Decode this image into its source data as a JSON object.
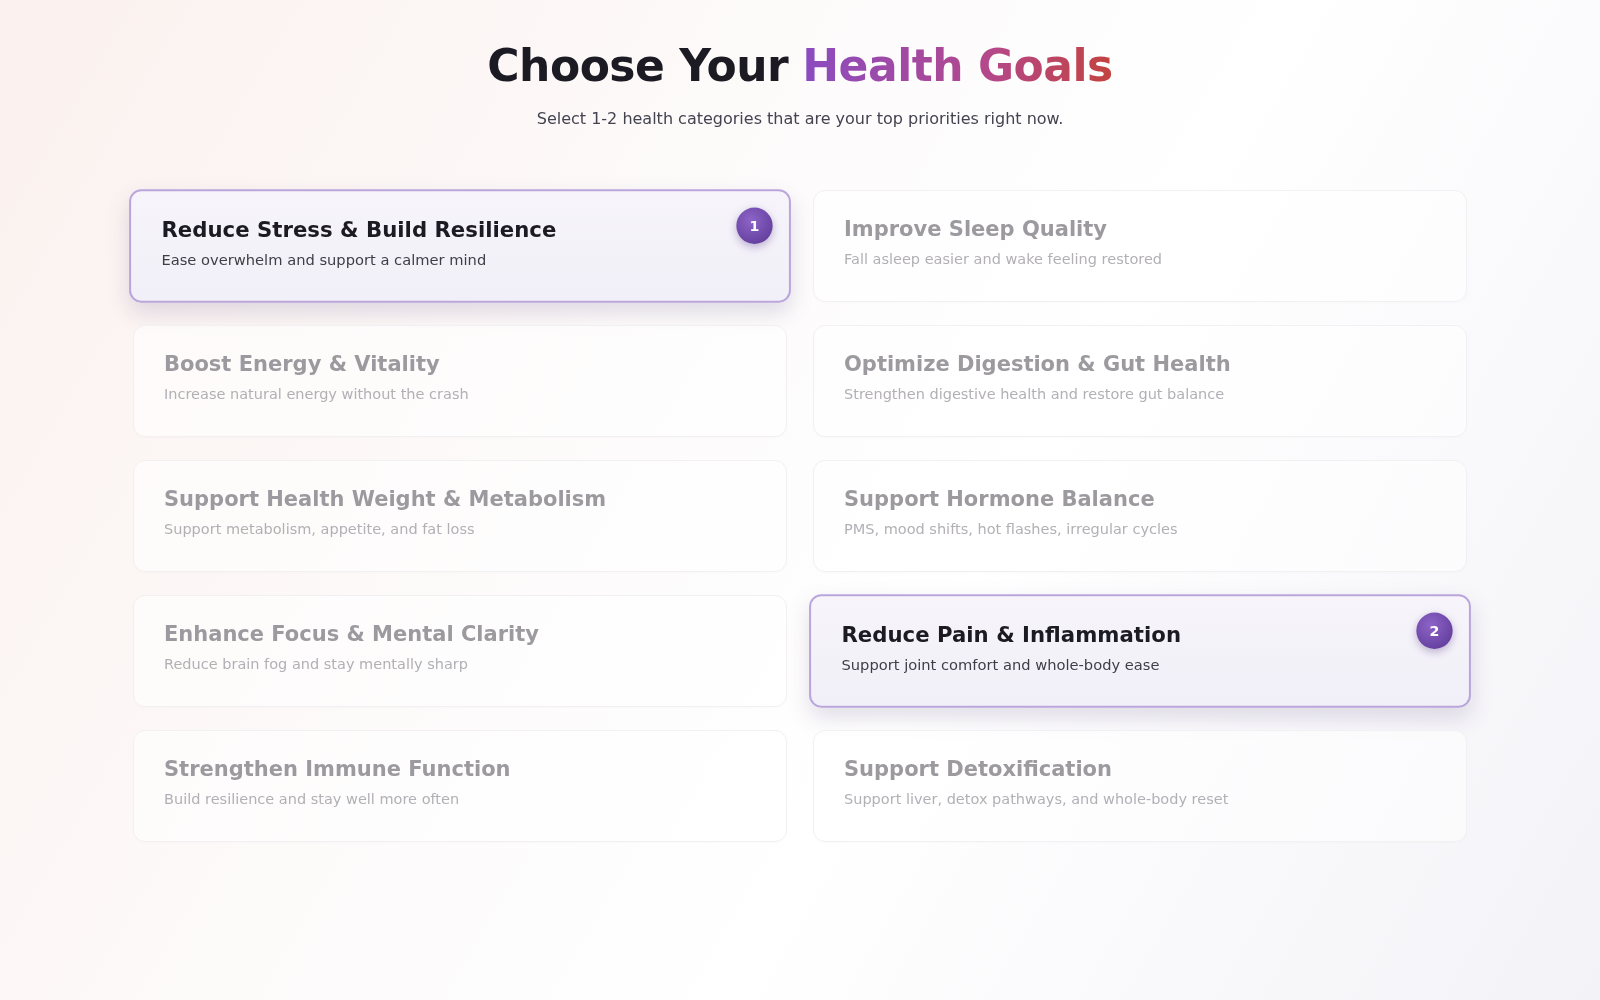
{
  "header": {
    "title": "Choose Your",
    "title_highlight": "Health Goals",
    "subtitle": "Select 1-2 health categories that are your top priorities right now."
  },
  "goals": [
    {
      "title": "Reduce Stress & Build Resilience",
      "description": "Ease overwhelm and support a calmer mind",
      "selected": true,
      "badge": "1"
    },
    {
      "title": "Improve Sleep Quality",
      "description": "Fall asleep easier and wake feeling restored",
      "selected": false
    },
    {
      "title": "Boost Energy & Vitality",
      "description": "Increase natural energy without the crash",
      "selected": false
    },
    {
      "title": "Optimize Digestion & Gut Health",
      "description": "Strengthen digestive health and restore gut balance",
      "selected": false
    },
    {
      "title": "Support Health Weight & Metabolism",
      "description": "Support metabolism, appetite, and fat loss",
      "selected": false
    },
    {
      "title": "Support Hormone Balance",
      "description": "PMS, mood shifts, hot flashes, irregular cycles",
      "selected": false
    },
    {
      "title": "Enhance Focus & Mental Clarity",
      "description": "Reduce brain fog and stay mentally sharp",
      "selected": false
    },
    {
      "title": "Reduce Pain & Inflammation",
      "description": "Support joint comfort and whole-body ease",
      "selected": true,
      "badge": "2"
    },
    {
      "title": "Strengthen Immune Function",
      "description": "Build resilience and stay well more often",
      "selected": false
    },
    {
      "title": "Support Detoxification",
      "description": "Support liver, detox pathways, and whole-body reset",
      "selected": false
    }
  ]
}
